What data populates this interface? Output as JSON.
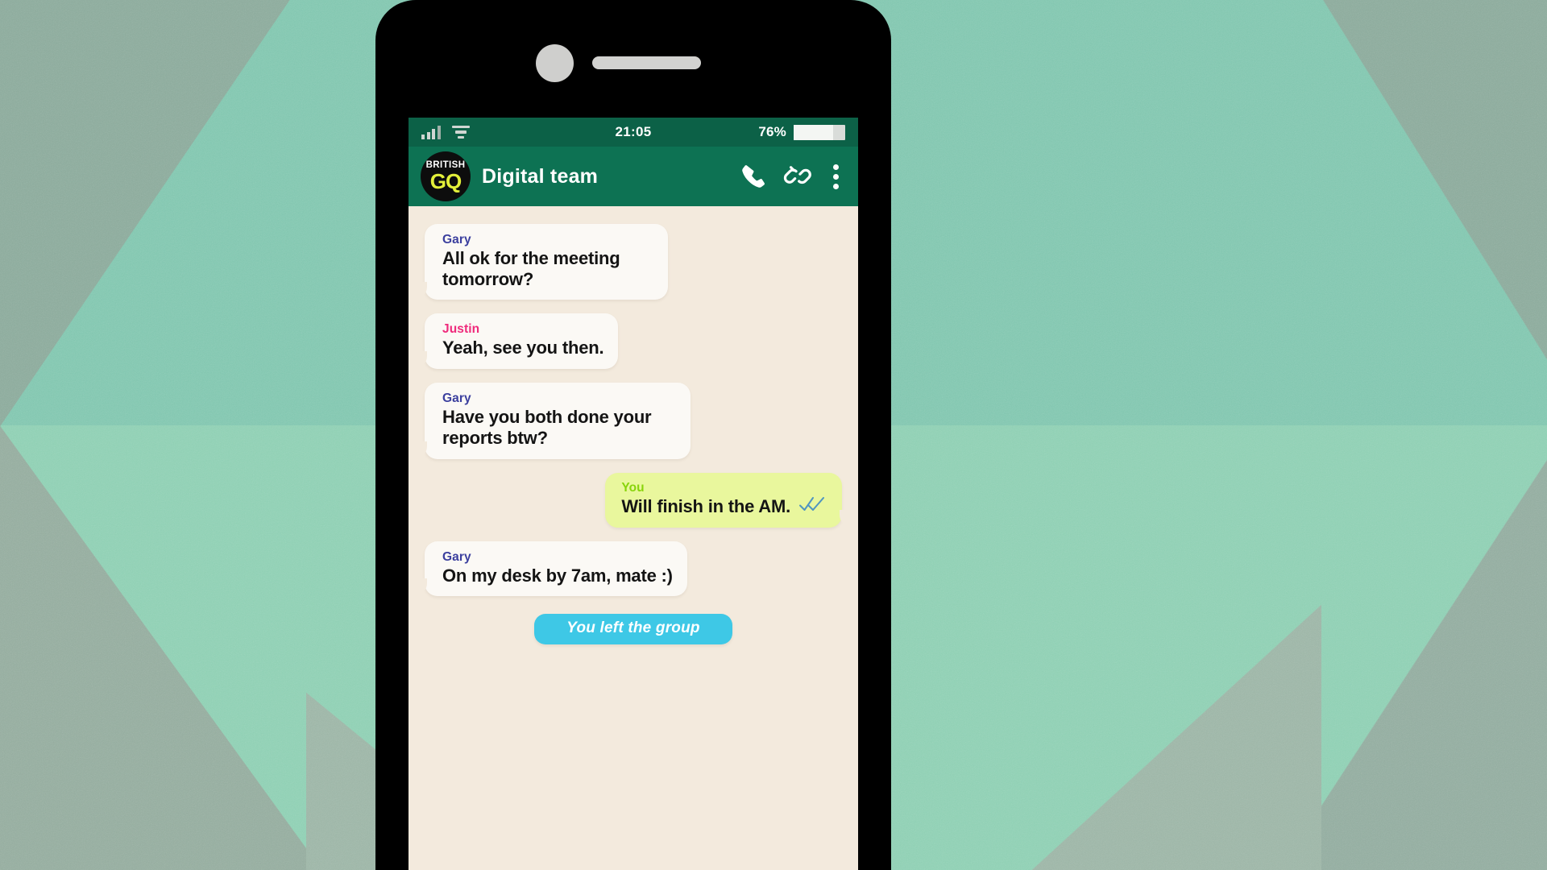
{
  "device": {
    "camera_icon": "front-camera",
    "speaker_icon": "earpiece-speaker"
  },
  "status_bar": {
    "signal_icon": "signal-bars-icon",
    "wifi_icon": "wifi-icon",
    "time": "21:05",
    "battery_percent": "76%",
    "battery_level": 76
  },
  "app_bar": {
    "avatar": {
      "line1": "BRITISH",
      "line2": "GQ"
    },
    "title": "Digital team",
    "actions": [
      {
        "name": "call-icon",
        "label": "Call"
      },
      {
        "name": "link-icon",
        "label": "Link"
      },
      {
        "name": "more-menu-icon",
        "label": "More options"
      }
    ]
  },
  "chat": {
    "messages": [
      {
        "sender": "Gary",
        "sender_color": "#3b3f9e",
        "text": "All ok for the meeting tomorrow?",
        "side": "them",
        "ticks": false
      },
      {
        "sender": "Justin",
        "sender_color": "#ef2a7b",
        "text": "Yeah, see you then.",
        "side": "them",
        "ticks": false
      },
      {
        "sender": "Gary",
        "sender_color": "#3b3f9e",
        "text": "Have you both done your reports btw?",
        "side": "them",
        "ticks": false
      },
      {
        "sender": "You",
        "sender_color": "#88d40b",
        "text": "Will finish in the AM.",
        "side": "me",
        "ticks": true
      },
      {
        "sender": "Gary",
        "sender_color": "#3b3f9e",
        "text": "On my desk by 7am, mate :)",
        "side": "them",
        "ticks": false
      }
    ],
    "system_notice": "You left the group"
  },
  "colors": {
    "status_bar_bg": "#0c6147",
    "app_bar_bg": "#0d7253",
    "chat_bg": "#f3eadd",
    "bubble_bg": "#fbf9f5",
    "bubble_mine_bg": "#e9f79d",
    "system_banner_bg": "#3ec8e6",
    "tick_blue": "#4a90bd",
    "wallpaper_green": "#82c7b0"
  }
}
